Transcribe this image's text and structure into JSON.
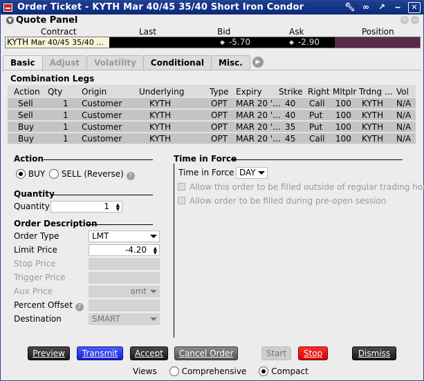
{
  "window": {
    "title": "Order Ticket - KYTH Mar 40/45 35/40 Short Iron Condor",
    "icons": [
      "wrench-icon",
      "link-icon",
      "pin-icon",
      "minimize-icon",
      "close-icon"
    ]
  },
  "quote_panel": {
    "title": "Quote Panel",
    "columns": {
      "contract": "Contract",
      "last": "Last",
      "bid": "Bid",
      "ask": "Ask",
      "position": "Position"
    },
    "contract_symbol": "KYTH",
    "contract_detail": "Mar 40/45 35/40 ...",
    "last": "",
    "bid": "-5.70",
    "ask": "-2.90",
    "position": ""
  },
  "tabs": [
    "Basic",
    "Adjust",
    "Volatility",
    "Conditional",
    "Misc."
  ],
  "active_tab": "Basic",
  "legs": {
    "title": "Combination Legs",
    "headers": {
      "action": "Action",
      "qty": "Qty",
      "origin": "Origin",
      "underlying": "Underlying",
      "type": "Type",
      "expiry": "Expiry",
      "strike": "Strike",
      "right": "Right",
      "mult": "Mltplr",
      "trading": "Trdng ...",
      "vol": "Vol"
    },
    "rows": [
      {
        "action": "Sell",
        "qty": "1",
        "origin": "Customer",
        "underlying": "KYTH",
        "type": "OPT",
        "expiry": "MAR 20 '...",
        "strike": "40",
        "right": "Call",
        "mult": "100",
        "trading": "KYTH",
        "vol": "N/A"
      },
      {
        "action": "Sell",
        "qty": "1",
        "origin": "Customer",
        "underlying": "KYTH",
        "type": "OPT",
        "expiry": "MAR 20 '...",
        "strike": "40",
        "right": "Put",
        "mult": "100",
        "trading": "KYTH",
        "vol": "N/A"
      },
      {
        "action": "Buy",
        "qty": "1",
        "origin": "Customer",
        "underlying": "KYTH",
        "type": "OPT",
        "expiry": "MAR 20 '...",
        "strike": "35",
        "right": "Put",
        "mult": "100",
        "trading": "KYTH",
        "vol": "N/A"
      },
      {
        "action": "Buy",
        "qty": "1",
        "origin": "Customer",
        "underlying": "KYTH",
        "type": "OPT",
        "expiry": "MAR 20 '...",
        "strike": "45",
        "right": "Call",
        "mult": "100",
        "trading": "KYTH",
        "vol": "N/A"
      }
    ]
  },
  "action": {
    "title": "Action",
    "buy": "BUY",
    "sell": "SELL (Reverse)",
    "selected": "BUY"
  },
  "quantity": {
    "title": "Quantity",
    "label": "Quantity",
    "value": "1"
  },
  "order_description": {
    "title": "Order Description",
    "order_type_label": "Order Type",
    "order_type": "LMT",
    "limit_price_label": "Limit Price",
    "limit_price": "-4.20",
    "stop_price_label": "Stop Price",
    "trigger_price_label": "Trigger Price",
    "aux_price_label": "Aux Price",
    "aux_price": "amt",
    "percent_offset_label": "Percent Offset",
    "destination_label": "Destination",
    "destination": "SMART"
  },
  "time_in_force": {
    "title": "Time in Force",
    "label": "Time in Force",
    "value": "DAY",
    "outside_rth": "Allow this order to be filled outside of regular trading hours",
    "pre_open": "Allow order to be filled during pre-open session"
  },
  "buttons": {
    "preview": "Preview",
    "transmit": "Transmit",
    "accept": "Accept",
    "cancel": "Cancel Order",
    "start": "Start",
    "stop": "Stop",
    "dismiss": "Dismiss"
  },
  "views": {
    "label": "Views",
    "comprehensive": "Comprehensive",
    "compact": "Compact",
    "selected": "Compact"
  }
}
